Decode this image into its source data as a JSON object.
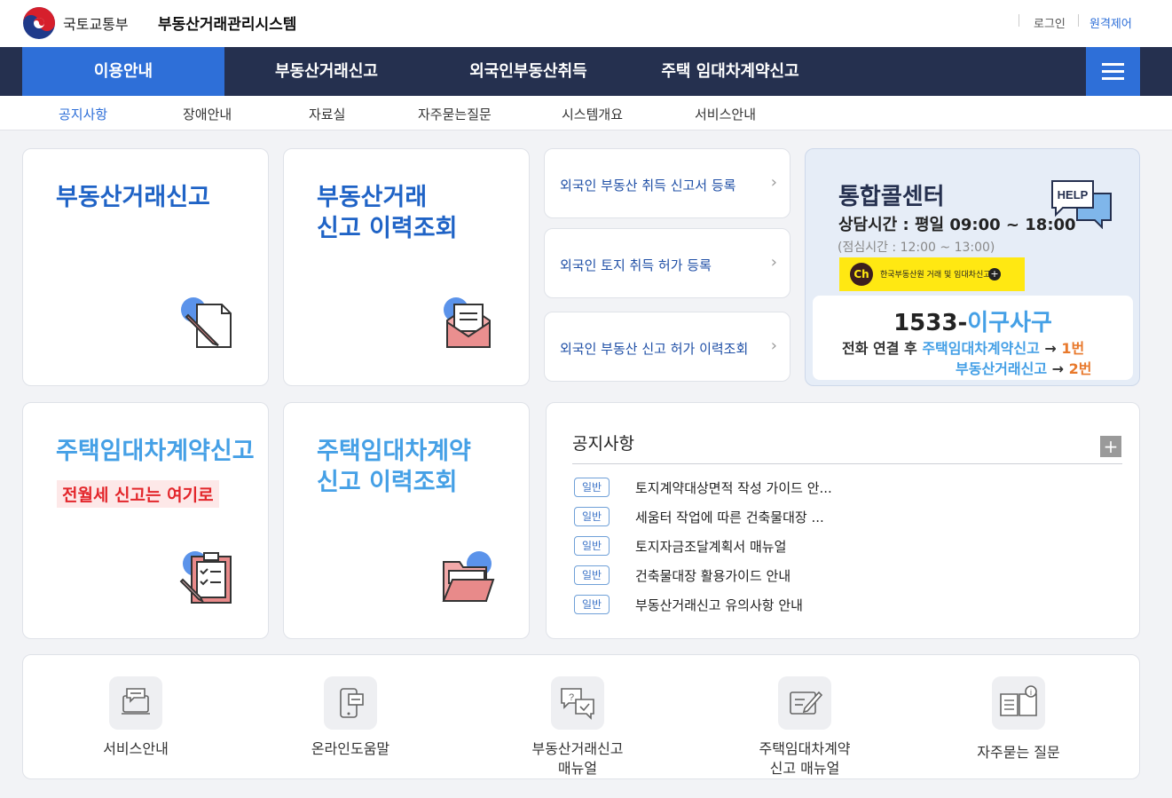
{
  "header": {
    "ministry": "국토교통부",
    "system_title": "부동산거래관리시스템",
    "login": "로그인",
    "remote_support": "원격제어"
  },
  "gnb": {
    "items": [
      "이용안내",
      "부동산거래신고",
      "외국인부동산취득",
      "주택 임대차계약신고"
    ],
    "active_index": 0,
    "menu_icon": "hamburger-menu-icon"
  },
  "lnb": {
    "items": [
      "공지사항",
      "장애안내",
      "자료실",
      "자주묻는질문",
      "시스템개요",
      "서비스안내"
    ],
    "active_index": 0
  },
  "cards": {
    "real_estate_report": {
      "title": "부동산거래신고",
      "icon": "pencil-document-icon"
    },
    "report_history": {
      "title_line1": "부동산거래",
      "title_line2": "신고 이력조회",
      "icon": "envelope-letter-icon"
    },
    "housing_lease_report": {
      "title": "주택임대차계약신고",
      "highlight": "전월세 신고는 여기로",
      "icon": "clipboard-checklist-icon"
    },
    "housing_lease_history": {
      "title_line1": "주택임대차계약",
      "title_line2": "신고 이력조회",
      "icon": "open-folder-icon"
    }
  },
  "foreign_links": [
    {
      "label": "외국인 부동산 취득 신고서 등록",
      "icon": "chevron-right-icon"
    },
    {
      "label": "외국인 토지 취득 허가 등록",
      "icon": "chevron-right-icon"
    },
    {
      "label": "외국인 부동산 신고 허가 이력조회",
      "icon": "chevron-right-icon"
    }
  ],
  "call_center": {
    "title": "통합콜센터",
    "hours": "상담시간 : 평일 09:00 ~ 18:00",
    "lunch": "(점심시간 : 12:00 ~ 13:00)",
    "help_icon_label": "HELP",
    "kakao_ch": "Ch",
    "kakao_text": "한국부동산원 거래 및 임대차신고",
    "kakao_plus": "+",
    "number_prefix": "1533-",
    "number_suffix": "이구사구",
    "line1_prefix": "전화 연결 후",
    "line1_service": "주택임대차계약신고",
    "line1_arrow": "→",
    "line1_num": "1번",
    "line2_service": "부동산거래신고",
    "line2_arrow": "→",
    "line2_num": "2번"
  },
  "notice": {
    "title": "공지사항",
    "more": "+",
    "items": [
      {
        "badge": "일반",
        "text": "토지계약대상면적 작성 가이드 안..."
      },
      {
        "badge": "일반",
        "text": "세움터 작업에 따른 건축물대장 ..."
      },
      {
        "badge": "일반",
        "text": "토지자금조달계획서 매뉴얼"
      },
      {
        "badge": "일반",
        "text": "건축물대장 활용가이드 안내"
      },
      {
        "badge": "일반",
        "text": "부동산거래신고 유의사항 안내"
      }
    ]
  },
  "quick_links": [
    {
      "line1": "서비스안내",
      "line2": "",
      "icon": "service-guide-icon"
    },
    {
      "line1": "온라인도움말",
      "line2": "",
      "icon": "online-help-icon"
    },
    {
      "line1": "부동산거래신고",
      "line2": "매뉴얼",
      "icon": "manual-chat-icon"
    },
    {
      "line1": "주택임대차계약",
      "line2": "신고 매뉴얼",
      "icon": "edit-manual-icon"
    },
    {
      "line1": "자주묻는 질문",
      "line2": "",
      "icon": "faq-book-icon"
    }
  ],
  "colors": {
    "navy": "#25304f",
    "accent_blue": "#2e6fd8",
    "card_blue_dark": "#1f63c6",
    "card_blue_light": "#45a0e6",
    "highlight_red": "#e3262b",
    "orange": "#e8792c",
    "kakao_yellow": "#ffe812"
  }
}
